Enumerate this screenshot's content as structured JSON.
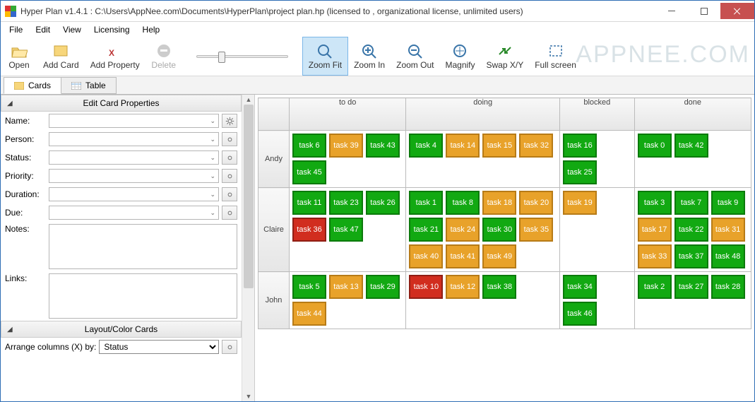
{
  "title": "Hyper Plan v1.4.1 : C:\\Users\\AppNee.com\\Documents\\HyperPlan\\project plan.hp (licensed to , organizational license, unlimited users)",
  "menu": [
    "File",
    "Edit",
    "View",
    "Licensing",
    "Help"
  ],
  "toolbar": {
    "open": "Open",
    "addcard": "Add Card",
    "addprop": "Add Property",
    "delete": "Delete",
    "zoomfit": "Zoom Fit",
    "zoomin": "Zoom In",
    "zoomout": "Zoom Out",
    "magnify": "Magnify",
    "swapxy": "Swap X/Y",
    "fullscreen": "Full screen"
  },
  "watermark": "APPNEE.COM",
  "tabs": {
    "cards": "Cards",
    "table": "Table"
  },
  "props": {
    "header": "Edit Card Properties",
    "labels": {
      "name": "Name:",
      "person": "Person:",
      "status": "Status:",
      "priority": "Priority:",
      "duration": "Duration:",
      "due": "Due:",
      "notes": "Notes:",
      "links": "Links:"
    }
  },
  "layout": {
    "header": "Layout/Color Cards",
    "arrange_label": "Arrange columns (X) by:",
    "arrange_value": "Status"
  },
  "board": {
    "columns": [
      "to do",
      "doing",
      "blocked",
      "done"
    ],
    "rows": [
      {
        "person": "Andy",
        "cells": [
          [
            {
              "t": "task 6",
              "c": "green"
            },
            {
              "t": "task 39",
              "c": "orange"
            },
            {
              "t": "task 43",
              "c": "green"
            },
            {
              "t": "task 45",
              "c": "green"
            }
          ],
          [
            {
              "t": "task 4",
              "c": "green"
            },
            {
              "t": "task 14",
              "c": "orange"
            },
            {
              "t": "task 15",
              "c": "orange"
            },
            {
              "t": "task 32",
              "c": "orange"
            }
          ],
          [
            {
              "t": "task 16",
              "c": "green"
            },
            {
              "t": "task 25",
              "c": "green"
            }
          ],
          [
            {
              "t": "task 0",
              "c": "green"
            },
            {
              "t": "task 42",
              "c": "green"
            }
          ]
        ]
      },
      {
        "person": "Claire",
        "cells": [
          [
            {
              "t": "task 11",
              "c": "green"
            },
            {
              "t": "task 23",
              "c": "green"
            },
            {
              "t": "task 26",
              "c": "green"
            },
            {
              "t": "task 36",
              "c": "red"
            },
            {
              "t": "task 47",
              "c": "green"
            }
          ],
          [
            {
              "t": "task 1",
              "c": "green"
            },
            {
              "t": "task 8",
              "c": "green"
            },
            {
              "t": "task 18",
              "c": "orange"
            },
            {
              "t": "task 20",
              "c": "orange"
            },
            {
              "t": "task 21",
              "c": "green"
            },
            {
              "t": "task 24",
              "c": "orange"
            },
            {
              "t": "task 30",
              "c": "green"
            },
            {
              "t": "task 35",
              "c": "orange"
            },
            {
              "t": "task 40",
              "c": "orange"
            },
            {
              "t": "task 41",
              "c": "orange"
            },
            {
              "t": "task 49",
              "c": "orange"
            }
          ],
          [
            {
              "t": "task 19",
              "c": "orange"
            }
          ],
          [
            {
              "t": "task 3",
              "c": "green"
            },
            {
              "t": "task 7",
              "c": "green"
            },
            {
              "t": "task 9",
              "c": "green"
            },
            {
              "t": "task 17",
              "c": "orange"
            },
            {
              "t": "task 22",
              "c": "green"
            },
            {
              "t": "task 31",
              "c": "orange"
            },
            {
              "t": "task 33",
              "c": "orange"
            },
            {
              "t": "task 37",
              "c": "green"
            },
            {
              "t": "task 48",
              "c": "green"
            }
          ]
        ]
      },
      {
        "person": "John",
        "cells": [
          [
            {
              "t": "task 5",
              "c": "green"
            },
            {
              "t": "task 13",
              "c": "orange"
            },
            {
              "t": "task 29",
              "c": "green"
            },
            {
              "t": "task 44",
              "c": "orange"
            }
          ],
          [
            {
              "t": "task 10",
              "c": "red"
            },
            {
              "t": "task 12",
              "c": "orange"
            },
            {
              "t": "task 38",
              "c": "green"
            }
          ],
          [
            {
              "t": "task 34",
              "c": "green"
            },
            {
              "t": "task 46",
              "c": "green"
            }
          ],
          [
            {
              "t": "task 2",
              "c": "green"
            },
            {
              "t": "task 27",
              "c": "green"
            },
            {
              "t": "task 28",
              "c": "green"
            }
          ]
        ]
      }
    ]
  }
}
